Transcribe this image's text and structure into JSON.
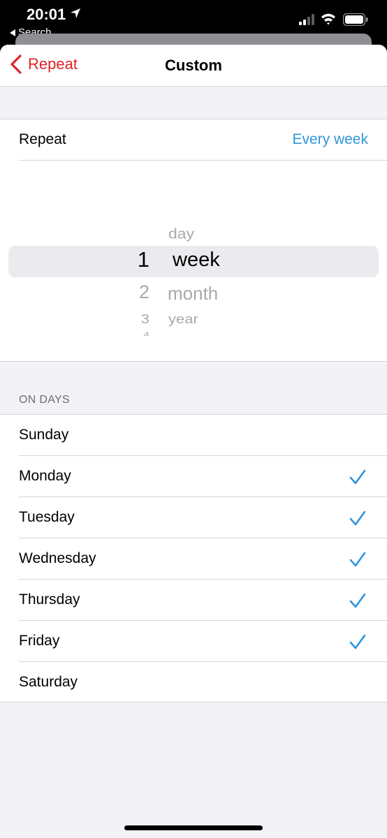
{
  "status_bar": {
    "time": "20:01",
    "back_app_label": "Search"
  },
  "navbar": {
    "back_label": "Repeat",
    "title": "Custom"
  },
  "repeat_row": {
    "label": "Repeat",
    "value": "Every week"
  },
  "picker": {
    "numbers": [
      "1",
      "2",
      "3",
      "4"
    ],
    "units": [
      "day",
      "week",
      "month",
      "year"
    ],
    "selected_number": "1",
    "selected_unit": "week"
  },
  "on_days": {
    "header": "ON DAYS",
    "days": [
      {
        "label": "Sunday",
        "checked": false
      },
      {
        "label": "Monday",
        "checked": true
      },
      {
        "label": "Tuesday",
        "checked": true
      },
      {
        "label": "Wednesday",
        "checked": true
      },
      {
        "label": "Thursday",
        "checked": true
      },
      {
        "label": "Friday",
        "checked": true
      },
      {
        "label": "Saturday",
        "checked": false
      }
    ]
  },
  "colors": {
    "accent_red": "#e0222a",
    "accent_blue": "#2f95dc",
    "grouped_background": "#f2f2f7"
  }
}
